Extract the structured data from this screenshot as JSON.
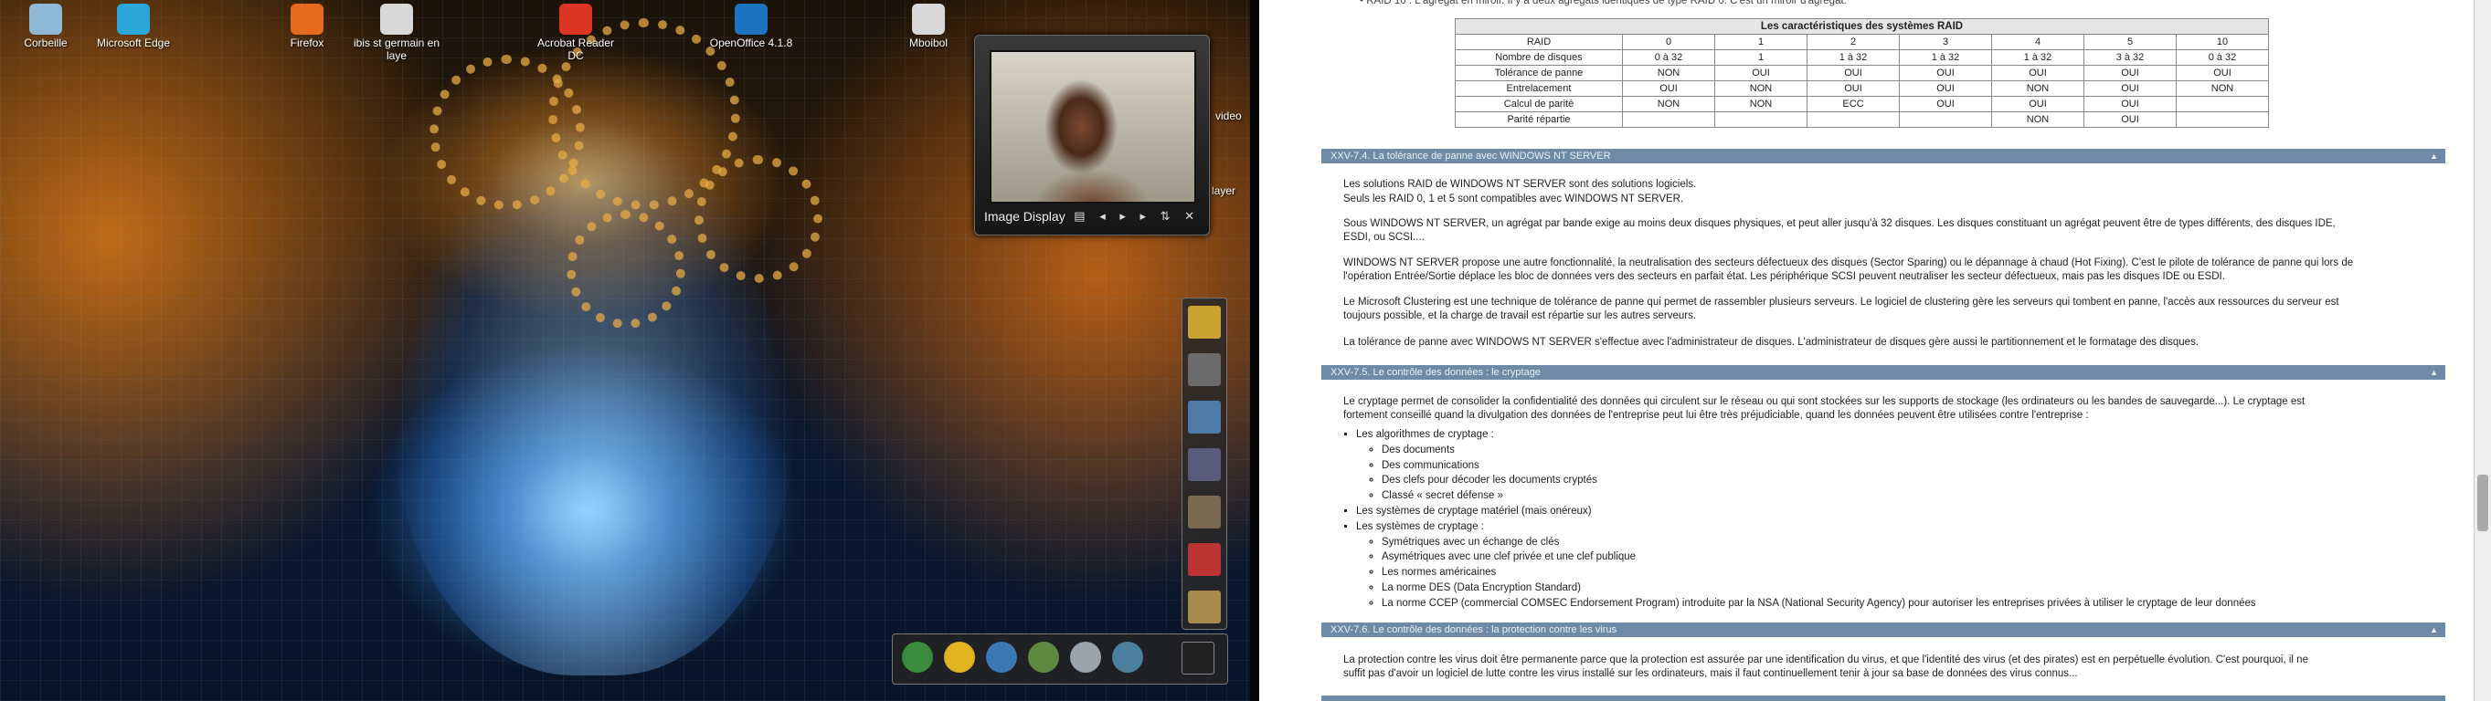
{
  "desktop": {
    "icons": [
      {
        "label": "Corbeille",
        "icon": "recycle-bin-icon",
        "color": "#8fb7d6"
      },
      {
        "label": "Microsoft Edge",
        "icon": "edge-icon",
        "color": "#2aa6d8"
      },
      {
        "label": "Firefox",
        "icon": "firefox-icon",
        "color": "#e66a1c"
      },
      {
        "label": "ibis st germain en laye",
        "icon": "file-icon",
        "color": "#d8d8d8"
      },
      {
        "label": "Acrobat Reader DC",
        "icon": "acrobat-icon",
        "color": "#d32"
      },
      {
        "label": "OpenOffice 4.1.8",
        "icon": "openoffice-icon",
        "color": "#1e73be"
      },
      {
        "label": "Mboibol",
        "icon": "file-icon",
        "color": "#d8d8d8"
      }
    ],
    "partial_labels": [
      "video",
      "layer"
    ],
    "image_display": {
      "caption": "Image Display",
      "controls": "▤ ◂ ▸ ▸ ⇅ ✕"
    },
    "dock_items": [
      "creator-pack-icon",
      "tools-icon",
      "photos-icon",
      "images-icon",
      "calendar-icon",
      "pdf-icon",
      "portrait-icon"
    ],
    "tray_items": [
      "app-icon",
      "face-icon",
      "gear-icon",
      "people-icon",
      "docs-icon",
      "shield-icon"
    ]
  },
  "page": {
    "top_fragment": "• RAID 10 : L'agrégat en miroir. Il y a deux agrégats identiques de type RAID 0. C'est un miroir d'agrégat.",
    "raid_table": {
      "caption": "Les caractéristiques des systèmes RAID",
      "header": [
        "RAID",
        "0",
        "1",
        "2",
        "3",
        "4",
        "5",
        "10"
      ],
      "rows": [
        [
          "Nombre de disques",
          "0 à 32",
          "1",
          "1 à 32",
          "1 à 32",
          "1 à 32",
          "3 à 32",
          "0 à 32"
        ],
        [
          "Tolérance de panne",
          "NON",
          "OUI",
          "OUI",
          "OUI",
          "OUI",
          "OUI",
          "OUI"
        ],
        [
          "Entrelacement",
          "OUI",
          "NON",
          "OUI",
          "OUI",
          "NON",
          "OUI",
          "NON"
        ],
        [
          "Calcul de parité",
          "NON",
          "NON",
          "ECC",
          "OUI",
          "OUI",
          "OUI",
          ""
        ],
        [
          "Parité répartie",
          "",
          "",
          "",
          "",
          "NON",
          "OUI",
          ""
        ]
      ]
    },
    "sections": [
      {
        "title": "XXV-7.4. La tolérance de panne avec WINDOWS NT SERVER",
        "toggle": "▲"
      },
      {
        "title": "XXV-7.5. Le contrôle des données : le cryptage",
        "toggle": "▲"
      },
      {
        "title": "XXV-7.6. Le contrôle des données : la protection contre les virus",
        "toggle": "▲"
      }
    ],
    "s4_paras": [
      "Les solutions RAID de WINDOWS NT SERVER sont des solutions logiciels.",
      "Seuls les RAID 0, 1 et 5 sont compatibles avec WINDOWS NT SERVER.",
      "Sous WINDOWS NT SERVER, un agrégat par bande exige au moins deux disques physiques, et peut aller jusqu'à 32 disques. Les disques constituant un agrégat peuvent être de types différents, des disques IDE,",
      "ESDI, ou SCSI....",
      "WINDOWS NT SERVER propose une autre fonctionnalité, la neutralisation des secteurs défectueux des disques (Sector Sparing) ou le dépannage à chaud (Hot Fixing). C'est le pilote de tolérance de panne qui lors de",
      "l'opération Entrée/Sortie déplace les bloc de données vers des secteurs en parfait état. Les périphérique SCSI peuvent neutraliser les secteur défectueux, mais pas les disques IDE ou ESDI.",
      "Le Microsoft Clustering est une technique de tolérance de panne qui permet de rassembler plusieurs serveurs. Le logiciel de clustering gère les serveurs qui tombent en panne, l'accès aux ressources du serveur est",
      "toujours possible, et la charge de travail est répartie sur les autres serveurs.",
      "La tolérance de panne avec WINDOWS NT SERVER s'effectue avec l'administrateur de disques. L'administrateur de disques gère aussi le partitionnement et le formatage des disques."
    ],
    "s5_paras": [
      "Le cryptage permet de consolider la confidentialité des données qui circulent sur le réseau ou qui sont stockées sur les supports de stockage (les ordinateurs ou les bandes de sauvegarde...). Le cryptage est",
      "fortement conseillé quand la divulgation des données de l'entreprise peut lui être très préjudiciable, quand les données peuvent être utilisées contre l'entreprise :"
    ],
    "s5_list": [
      {
        "text": "Les algorithmes de cryptage :",
        "sub": [
          "Des documents",
          "Des communications",
          "Des clefs pour décoder les documents cryptés",
          "Classé « secret défense »"
        ]
      },
      {
        "text": "Les systèmes de cryptage matériel (mais onéreux)",
        "sub": []
      },
      {
        "text": "Les systèmes de cryptage :",
        "sub": [
          "Symétriques avec un échange de clés",
          "Asymétriques avec une clef privée et une clef publique",
          "Les normes américaines",
          "La norme DES (Data Encryption Standard)",
          "La norme CCEP (commercial COMSEC Endorsement Program) introduite par la NSA (National Security Agency) pour autoriser les entreprises privées à utiliser le cryptage de leur données"
        ]
      }
    ],
    "s6_paras": [
      "La protection contre les virus doit être permanente parce que la protection est assurée par une identification du virus, et que l'identité des virus (et des pirates) est en perpétuelle évolution. C'est pourquoi, il ne",
      "suffit pas d'avoir un logiciel de lutte contre les virus installé sur les ordinateurs, mais il faut continuellement tenir à jour sa base de données des virus connus..."
    ]
  }
}
